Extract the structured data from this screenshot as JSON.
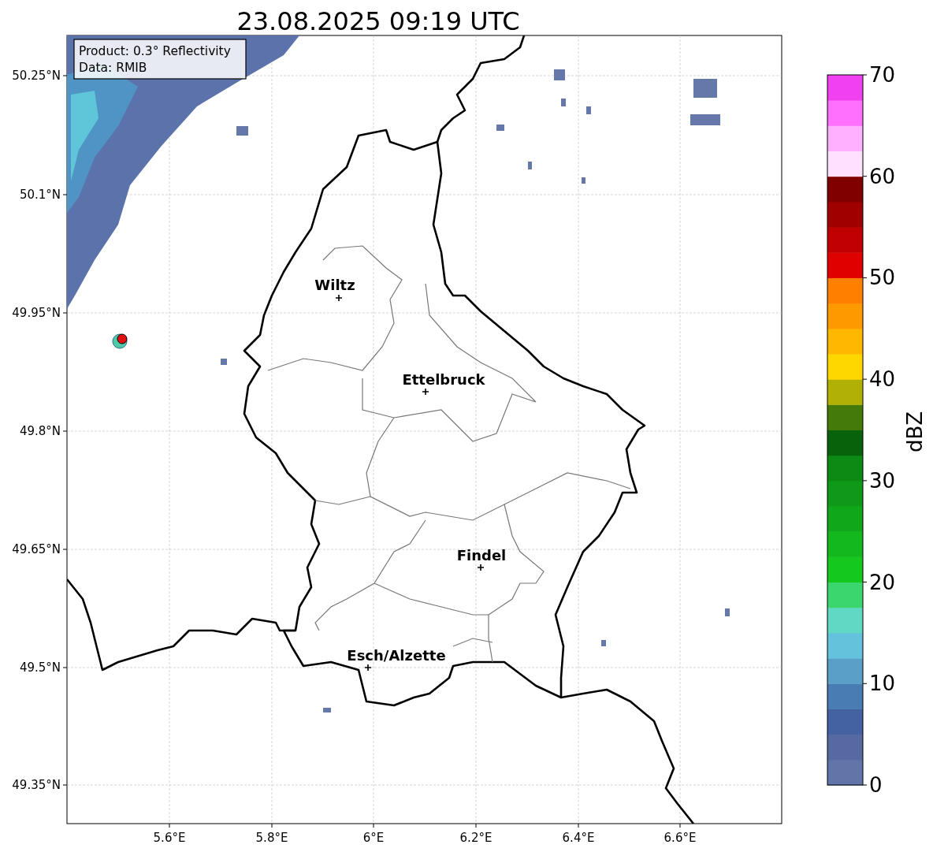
{
  "title": "23.08.2025 09:19 UTC",
  "info_box": {
    "lines": [
      "Product: 0.3° Reflectivity",
      "Data: RMIB"
    ]
  },
  "map": {
    "cities": [
      {
        "name": "Wiltz"
      },
      {
        "name": "Ettelbruck"
      },
      {
        "name": "Findel"
      },
      {
        "name": "Esch/Alzette"
      }
    ]
  },
  "x_axis": {
    "ticks": [
      "5.6°E",
      "5.8°E",
      "6°E",
      "6.2°E",
      "6.4°E",
      "6.6°E"
    ]
  },
  "y_axis": {
    "ticks": [
      "50.25°N",
      "50.1°N",
      "49.95°N",
      "49.8°N",
      "49.65°N",
      "49.5°N",
      "49.35°N"
    ]
  },
  "colorbar": {
    "label": "dBZ",
    "ticks": [
      "70",
      "60",
      "50",
      "40",
      "30",
      "20",
      "10",
      "0"
    ]
  }
}
